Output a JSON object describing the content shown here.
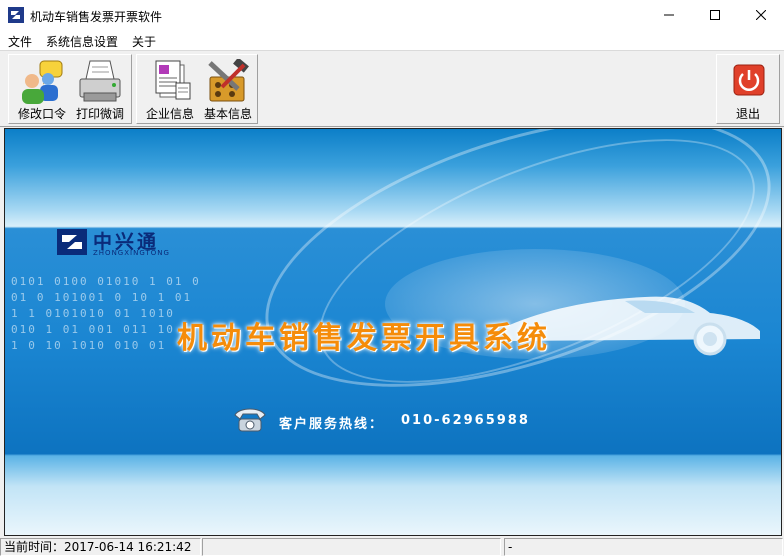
{
  "window": {
    "title": "机动车销售发票开票软件"
  },
  "menu": {
    "items": [
      "文件",
      "系统信息设置",
      "关于"
    ]
  },
  "toolbar": {
    "change_password": "修改口令",
    "print_adjust": "打印微调",
    "company_info": "企业信息",
    "basic_info": "基本信息",
    "exit": "退出"
  },
  "banner": {
    "logo_cn": "中兴通",
    "logo_en": "ZHONGXINGTONG",
    "title": "机动车销售发票开具系统",
    "hotline_label": "客户服务热线：",
    "hotline_number": "010-62965988",
    "binary_rows": [
      "0101 0100 01010 1 01 0",
      "01 0 101001 0 10 1 01",
      "1 1 0101010 01 1010",
      "010 1 01 001 011 10",
      "1 0 10 1010 010 01"
    ]
  },
  "status": {
    "current_time": "当前时间：2017-06-14 16:21:42",
    "panel2": "",
    "panel3": "-"
  },
  "colors": {
    "title_orange": "#f58c0a",
    "logo_navy": "#0a2b7a",
    "exit_red": "#e0402a"
  }
}
